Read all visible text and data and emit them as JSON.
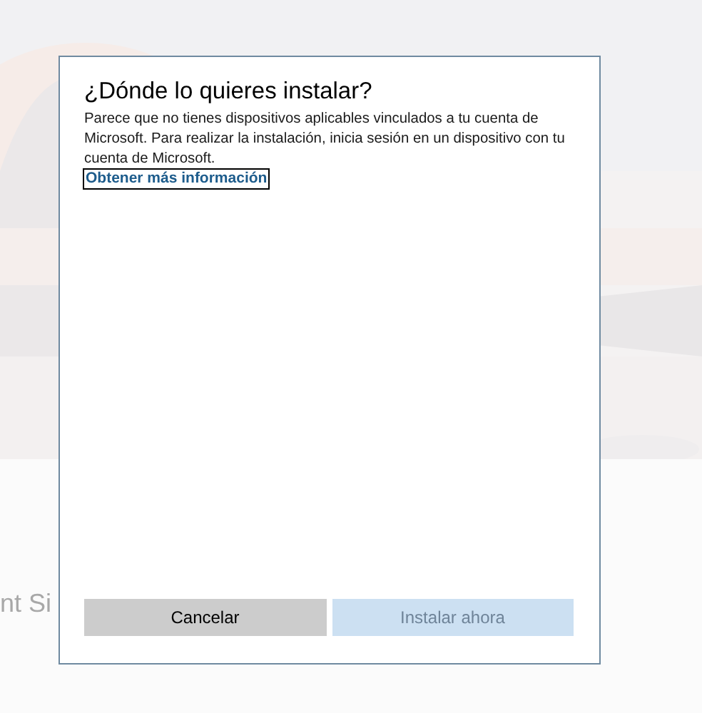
{
  "background": {
    "title_fragment": "nt Si"
  },
  "dialog": {
    "title": "¿Dónde lo quieres instalar?",
    "message": "Parece que no tienes dispositivos aplicables vinculados a tu cuenta de Microsoft. Para realizar la instalación, inicia sesión en un dispositivo con tu cuenta de Microsoft.",
    "link": {
      "label": "Obtener más información",
      "focused": true
    },
    "buttons": [
      {
        "label": "Cancelar",
        "kind": "secondary",
        "disabled": false
      },
      {
        "label": "Instalar ahora",
        "kind": "primary",
        "disabled": true
      }
    ]
  }
}
